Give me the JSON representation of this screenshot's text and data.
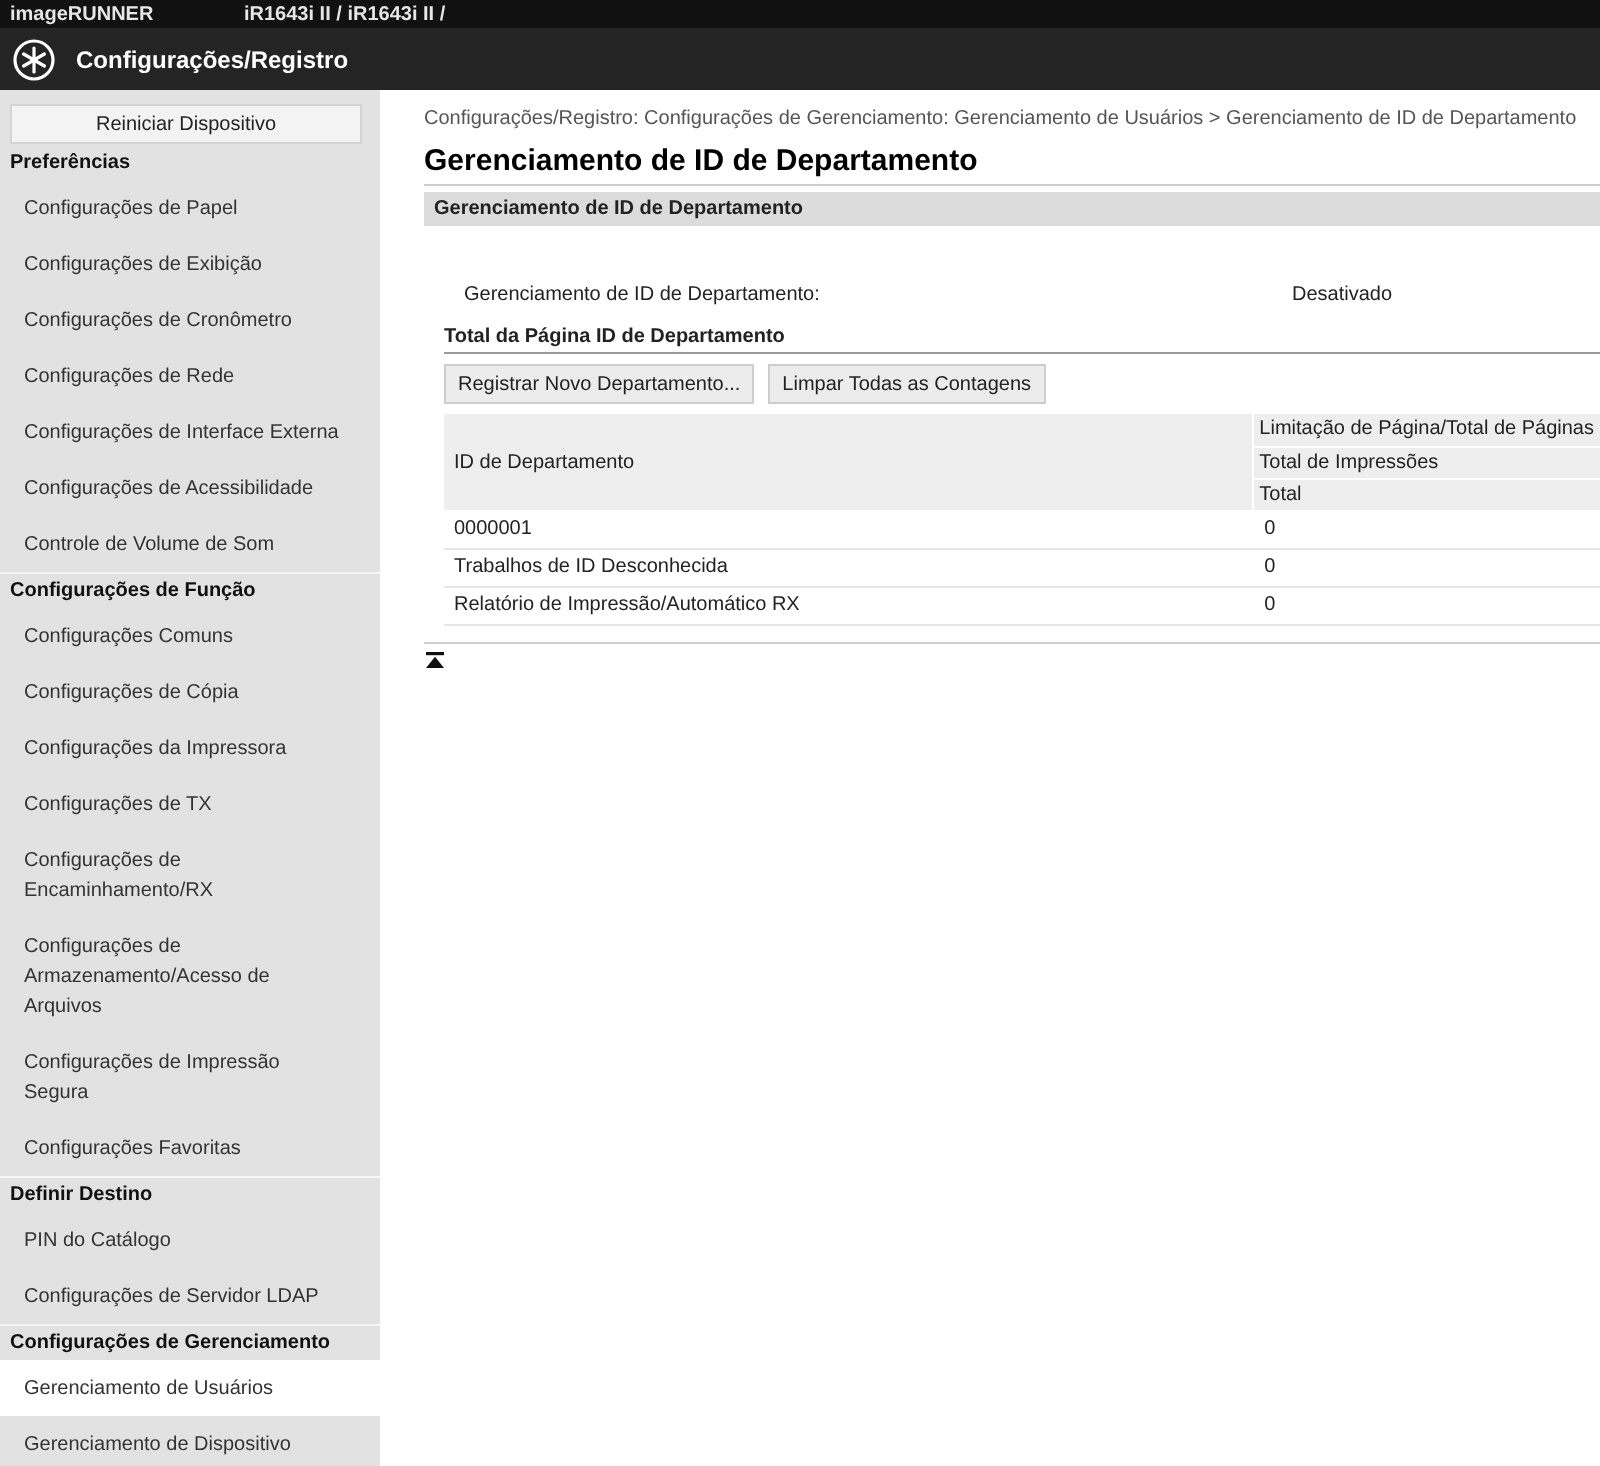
{
  "header": {
    "brand": "imageRUNNER",
    "model": "iR1643i II / iR1643i II /",
    "title": "Configurações/Registro"
  },
  "sidebar": {
    "button": "Reiniciar Dispositivo",
    "sections": [
      {
        "title": "Preferências",
        "items": [
          {
            "label": "Configurações de Papel",
            "selected": false
          },
          {
            "label": "Configurações de Exibição",
            "selected": false
          },
          {
            "label": "Configurações de Cronômetro",
            "selected": false
          },
          {
            "label": "Configurações de Rede",
            "selected": false
          },
          {
            "label": "Configurações de Interface Externa",
            "selected": false
          },
          {
            "label": "Configurações de Acessibilidade",
            "selected": false
          },
          {
            "label": "Controle de Volume de Som",
            "selected": false
          }
        ]
      },
      {
        "title": "Configurações de Função",
        "items": [
          {
            "label": "Configurações Comuns",
            "selected": false
          },
          {
            "label": "Configurações de Cópia",
            "selected": false
          },
          {
            "label": "Configurações da Impressora",
            "selected": false
          },
          {
            "label": "Configurações de TX",
            "selected": false
          },
          {
            "label": "Configurações de Encaminhamento/RX",
            "selected": false
          },
          {
            "label": "Configurações de Armazenamento/Acesso de Arquivos",
            "selected": false
          },
          {
            "label": "Configurações de Impressão Segura",
            "selected": false
          },
          {
            "label": "Configurações Favoritas",
            "selected": false
          }
        ]
      },
      {
        "title": "Definir Destino",
        "items": [
          {
            "label": "PIN do Catálogo",
            "selected": false
          },
          {
            "label": "Configurações de Servidor LDAP",
            "selected": false
          }
        ]
      },
      {
        "title": "Configurações de Gerenciamento",
        "items": [
          {
            "label": "Gerenciamento de Usuários",
            "selected": true
          },
          {
            "label": "Gerenciamento de Dispositivo",
            "selected": false
          }
        ]
      }
    ]
  },
  "main": {
    "breadcrumb": "Configurações/Registro: Configurações de Gerenciamento: Gerenciamento de Usuários > Gerenciamento de ID de Departamento",
    "title": "Gerenciamento de ID de Departamento",
    "section_title": "Gerenciamento de ID de Departamento",
    "setting": {
      "label": "Gerenciamento de ID de Departamento:",
      "value": "Desativado"
    },
    "subsection_title": "Total da Página ID de Departamento",
    "buttons": [
      "Registrar Novo Departamento...",
      "Limpar Todas as Contagens"
    ],
    "table": {
      "id_header": "ID de Departamento",
      "count_headers": [
        "Limitação de Página/Total de Páginas",
        "Total de Impressões",
        "Total"
      ],
      "rows": [
        {
          "id": "0000001",
          "total": "0"
        },
        {
          "id": "Trabalhos de ID Desconhecida",
          "total": "0"
        },
        {
          "id": "Relatório de Impressão/Automático RX",
          "total": "0"
        }
      ]
    }
  }
}
